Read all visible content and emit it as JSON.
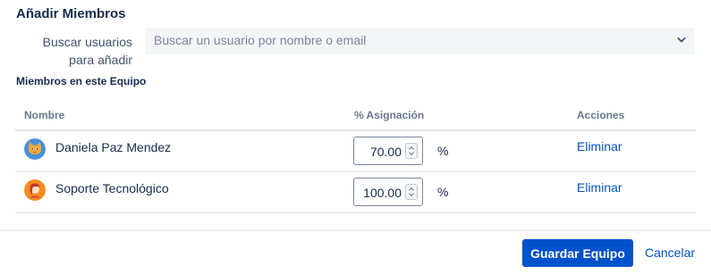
{
  "section": {
    "title": "Añadir Miembros"
  },
  "search": {
    "label_line1": "Buscar usuarios",
    "label_line2": "para añadir",
    "placeholder": "Buscar un usuario por nombre o email",
    "chevron_icon": "chevron-down-icon"
  },
  "members": {
    "title": "Miembros en este Equipo",
    "headers": {
      "name": "Nombre",
      "allocation": "% Asignación",
      "actions": "Acciones"
    },
    "rows": [
      {
        "name": "Daniela Paz Mendez",
        "allocation": "70.00",
        "unit": "%",
        "action": "Eliminar",
        "avatar_icon": "cat-avatar-icon"
      },
      {
        "name": "Soporte Tecnológico",
        "allocation": "100.00",
        "unit": "%",
        "action": "Eliminar",
        "avatar_icon": "person-avatar-icon"
      }
    ]
  },
  "footer": {
    "save_label": "Guardar Equipo",
    "cancel_label": "Cancelar"
  },
  "colors": {
    "primary": "#0052cc",
    "text": "#172b4d",
    "muted": "#6b778c",
    "input_bg": "#f4f5f7",
    "border": "#dfe1e6"
  }
}
